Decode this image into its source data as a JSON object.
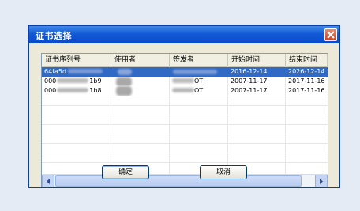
{
  "dialog": {
    "title": "证书选择",
    "columns": [
      "证书序列号",
      "使用者",
      "签发者",
      "开始时间",
      "结束时间"
    ],
    "rows": [
      {
        "serial": "64fa5d",
        "subject": "",
        "issuer": "",
        "start": "2016-12-14",
        "end": "2026-12-14",
        "selected": true
      },
      {
        "serial": "000",
        "serial_tail": "1b9",
        "subject": "",
        "issuer": "",
        "issuer_tail": "OT",
        "start": "2007-11-17",
        "end": "2017-11-16",
        "selected": false
      },
      {
        "serial": "000",
        "serial_tail": "1b8",
        "subject": "",
        "issuer": "",
        "issuer_tail": "OT",
        "start": "2007-11-17",
        "end": "2017-11-16",
        "selected": false
      }
    ],
    "ok_label": "确定",
    "cancel_label": "取消"
  },
  "colors": {
    "title_bar": "#1359d6",
    "selection": "#316ac5",
    "dialog_bg": "#ece9d8",
    "page_bg": "#e4ebf4"
  },
  "icons": {
    "close": "close-icon",
    "scroll_left": "arrow-left-icon",
    "scroll_right": "arrow-right-icon"
  }
}
